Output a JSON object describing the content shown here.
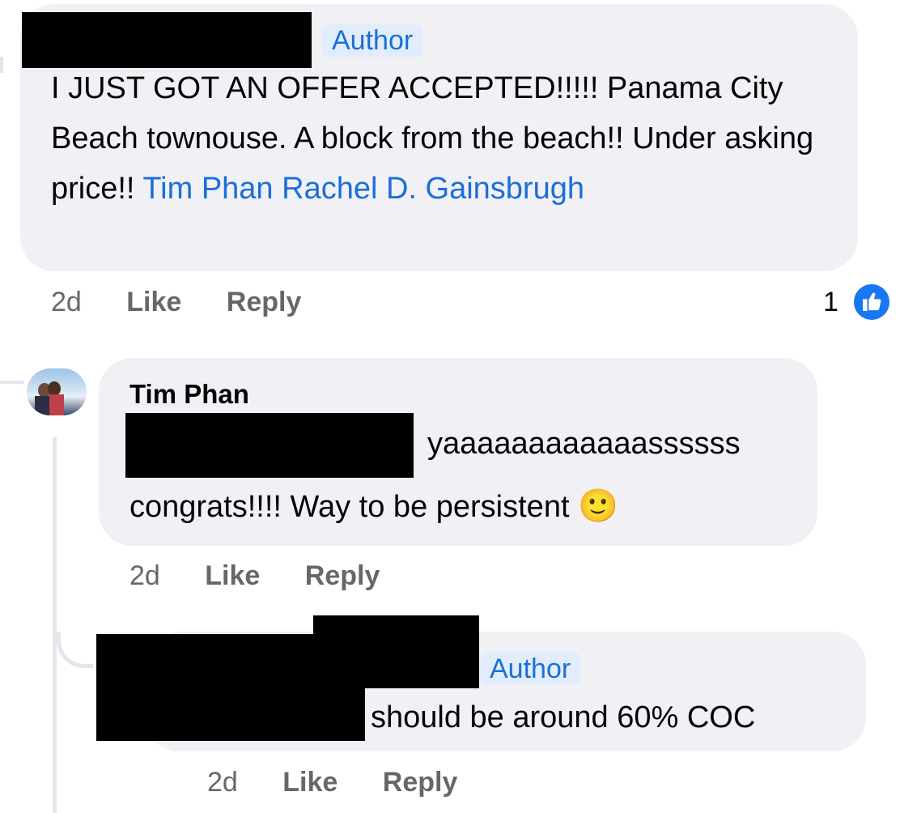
{
  "comment1": {
    "author_badge": "Author",
    "text_plain": "I JUST GOT AN OFFER ACCEPTED!!!!! Panama City Beach townouse. A block from the beach!! Under asking price!! ",
    "mentions": [
      "Tim Phan",
      "Rachel D. Gainsbrugh"
    ],
    "time": "2d",
    "like": "Like",
    "reply": "Reply",
    "reaction_count": "1",
    "reaction_icon": "thumbs-up-icon",
    "reaction_color": "#1877f2"
  },
  "comment2": {
    "name": "Tim Phan",
    "text_line1": "yaaaaaaaaaaaassssss",
    "text_line2": "congrats!!!! Way to be persistent",
    "emoji": "🙂",
    "time": "2d",
    "like": "Like",
    "reply": "Reply"
  },
  "comment3": {
    "author_badge": "Author",
    "text": "should be around 60% COC",
    "time": "2d",
    "like": "Like",
    "reply": "Reply"
  },
  "colors": {
    "bubble": "#f0f0f5",
    "mention": "#1c6fd6",
    "meta": "#65676b"
  }
}
